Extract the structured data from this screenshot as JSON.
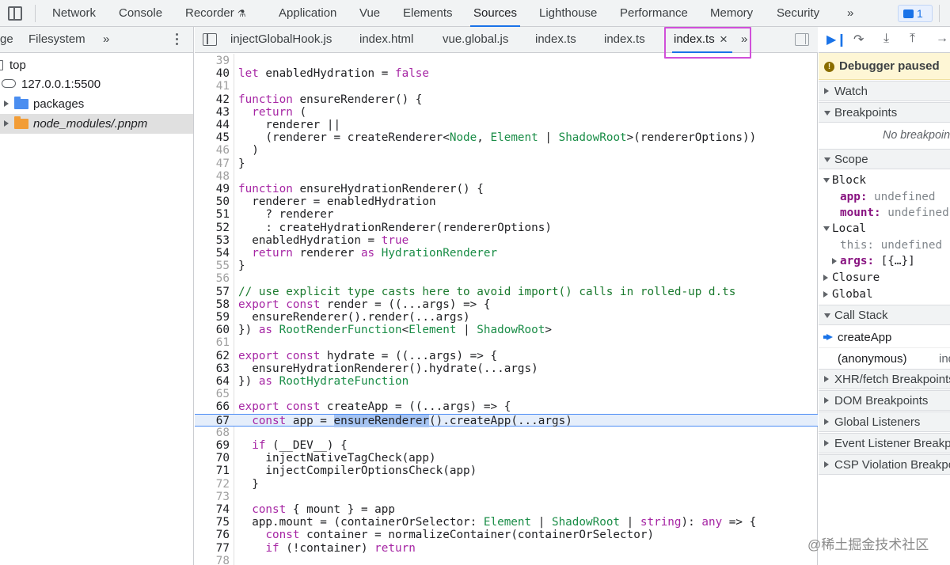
{
  "panel_tabs": [
    "Network",
    "Console",
    "Recorder",
    "Application",
    "Vue",
    "Elements",
    "Sources",
    "Lighthouse",
    "Performance",
    "Memory",
    "Security"
  ],
  "panel_more": "»",
  "issues_count": "1",
  "navigator": {
    "tabs": [
      "ge",
      "Filesystem"
    ],
    "more": "»",
    "tree": [
      {
        "label": "top"
      },
      {
        "label": "127.0.0.1:5500"
      },
      {
        "label": "packages"
      },
      {
        "label": "node_modules/.pnpm"
      }
    ]
  },
  "editor": {
    "tabs": [
      "injectGlobalHook.js",
      "index.html",
      "vue.global.js",
      "index.ts",
      "index.ts",
      "index.ts"
    ],
    "close_glyph": "×",
    "more": "»",
    "lines": [
      {
        "n": "39",
        "t": ""
      },
      {
        "n": "40",
        "t": "let enabledHydration = false"
      },
      {
        "n": "41",
        "t": ""
      },
      {
        "n": "42",
        "t": "function ensureRenderer() {"
      },
      {
        "n": "43",
        "t": "  return ("
      },
      {
        "n": "44",
        "t": "    renderer ||"
      },
      {
        "n": "45",
        "t": "    (renderer = createRenderer<Node, Element | ShadowRoot>(rendererOptions))"
      },
      {
        "n": "46",
        "t": "  )"
      },
      {
        "n": "47",
        "t": "}"
      },
      {
        "n": "48",
        "t": ""
      },
      {
        "n": "49",
        "t": "function ensureHydrationRenderer() {"
      },
      {
        "n": "50",
        "t": "  renderer = enabledHydration"
      },
      {
        "n": "51",
        "t": "    ? renderer"
      },
      {
        "n": "52",
        "t": "    : createHydrationRenderer(rendererOptions)"
      },
      {
        "n": "53",
        "t": "  enabledHydration = true"
      },
      {
        "n": "54",
        "t": "  return renderer as HydrationRenderer"
      },
      {
        "n": "55",
        "t": "}"
      },
      {
        "n": "56",
        "t": ""
      },
      {
        "n": "57",
        "t": "// use explicit type casts here to avoid import() calls in rolled-up d.ts"
      },
      {
        "n": "58",
        "t": "export const render = ((...args) => {"
      },
      {
        "n": "59",
        "t": "  ensureRenderer().render(...args)"
      },
      {
        "n": "60",
        "t": "}) as RootRenderFunction<Element | ShadowRoot>"
      },
      {
        "n": "61",
        "t": ""
      },
      {
        "n": "62",
        "t": "export const hydrate = ((...args) => {"
      },
      {
        "n": "63",
        "t": "  ensureHydrationRenderer().hydrate(...args)"
      },
      {
        "n": "64",
        "t": "}) as RootHydrateFunction"
      },
      {
        "n": "65",
        "t": ""
      },
      {
        "n": "66",
        "t": "export const createApp = ((...args) => {"
      },
      {
        "n": "67",
        "t": "  const app = ensureRenderer().createApp(...args)"
      },
      {
        "n": "68",
        "t": ""
      },
      {
        "n": "69",
        "t": "  if (__DEV__) {"
      },
      {
        "n": "70",
        "t": "    injectNativeTagCheck(app)"
      },
      {
        "n": "71",
        "t": "    injectCompilerOptionsCheck(app)"
      },
      {
        "n": "72",
        "t": "  }"
      },
      {
        "n": "73",
        "t": ""
      },
      {
        "n": "74",
        "t": "  const { mount } = app"
      },
      {
        "n": "75",
        "t": "  app.mount = (containerOrSelector: Element | ShadowRoot | string): any => {"
      },
      {
        "n": "76",
        "t": "    const container = normalizeContainer(containerOrSelector)"
      },
      {
        "n": "77",
        "t": "    if (!container) return"
      },
      {
        "n": "78",
        "t": ""
      }
    ]
  },
  "debugger": {
    "paused_label": "Debugger paused",
    "watch": "Watch",
    "breakpoints": "Breakpoints",
    "no_breakpoints": "No breakpoints",
    "scope": "Scope",
    "block": "Block",
    "block_vars": [
      {
        "name": "app",
        "value": "undefined"
      },
      {
        "name": "mount",
        "value": "undefined"
      }
    ],
    "local": "Local",
    "local_this": "this: undefined",
    "local_args_name": "args",
    "local_args_value": "[{…}]",
    "closure": "Closure",
    "global": "Global",
    "call_stack": "Call Stack",
    "frames": [
      {
        "name": "createApp",
        "loc": ""
      },
      {
        "name": "(anonymous)",
        "loc": "index.html"
      }
    ],
    "xhr": "XHR/fetch Breakpoints",
    "dom": "DOM Breakpoints",
    "global_listeners": "Global Listeners",
    "event_listener": "Event Listener Breakpoints",
    "csp": "CSP Violation Breakpoints"
  },
  "watermark": "@稀土掘金技术社区",
  "colors": {
    "accent": "#1a73e8",
    "active_tab_border": "#d04fd9",
    "paused_bg": "#fef6d5",
    "exec_line": "#e5eefb"
  }
}
